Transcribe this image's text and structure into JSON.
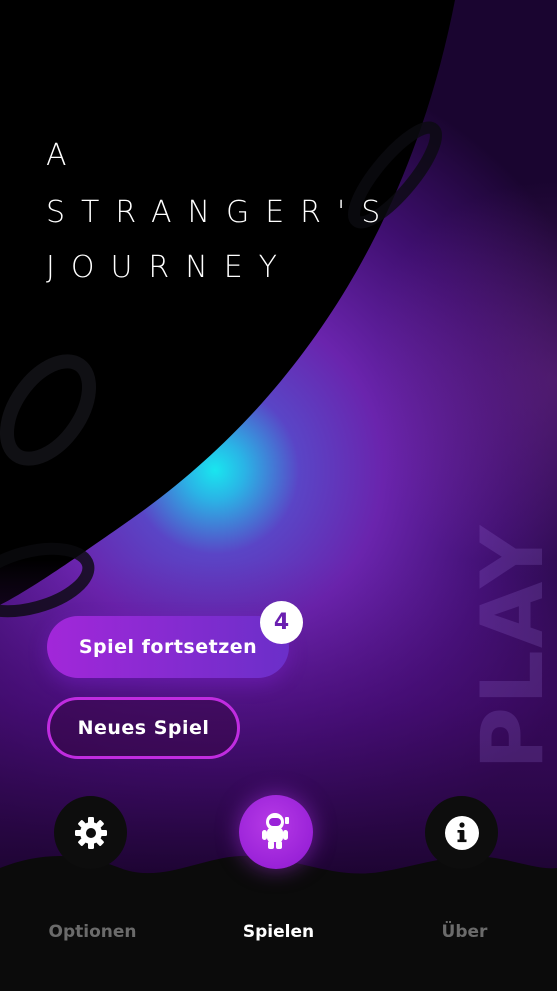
{
  "title": {
    "line1": "A",
    "line2": "STRANGER'S",
    "line3": "JOURNEY"
  },
  "background_word": "PLAY",
  "actions": {
    "continue_label": "Spiel fortsetzen",
    "continue_badge": "4",
    "new_game_label": "Neues Spiel"
  },
  "nav": {
    "items": [
      {
        "label": "Optionen",
        "icon": "gear-icon",
        "active": false
      },
      {
        "label": "Spielen",
        "icon": "astronaut-icon",
        "active": true
      },
      {
        "label": "Über",
        "icon": "info-icon",
        "active": false
      }
    ]
  },
  "colors": {
    "background": "#000000",
    "planet_purple": "#5a1a9a",
    "planet_glow": "#1fe0f0",
    "accent": "#a227d9",
    "accent_border": "#c02ce0",
    "nav_bar": "#0b0b0b",
    "nav_inactive": "#6b6b6b",
    "nav_active": "#ffffff"
  }
}
